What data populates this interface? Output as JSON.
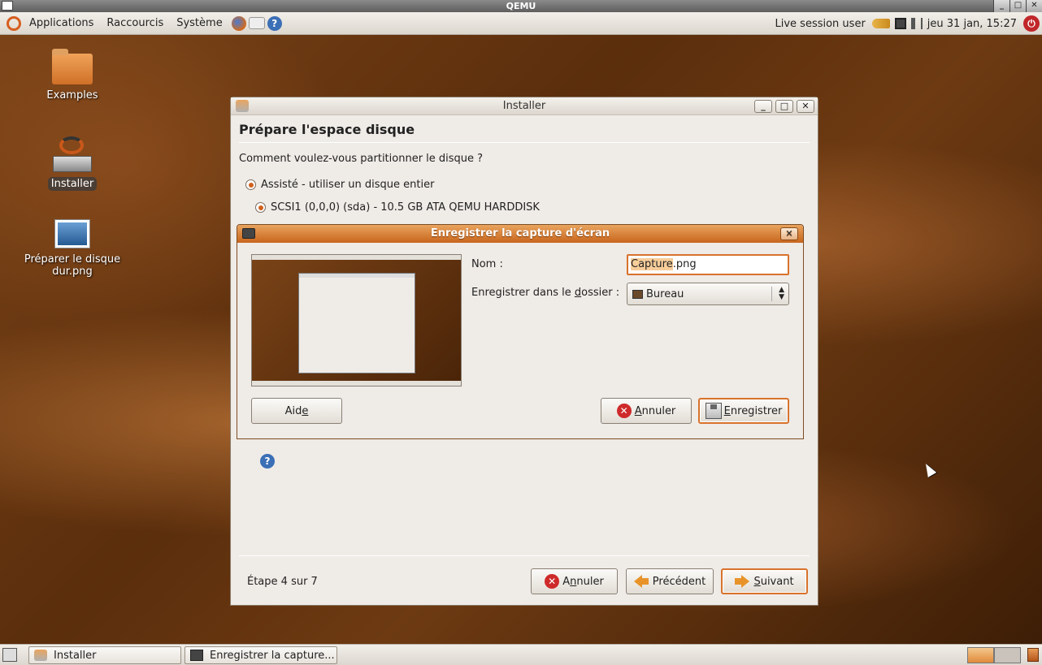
{
  "qemu": {
    "title": "QEMU"
  },
  "top_panel": {
    "menus": [
      "Applications",
      "Raccourcis",
      "Système"
    ],
    "launchers": [
      "firefox-icon",
      "mail-icon",
      "help-icon"
    ],
    "user": "Live session user",
    "clock": "jeu 31 jan, 15:27"
  },
  "desktop_icons": [
    {
      "label": "Examples",
      "icon": "folder-icon"
    },
    {
      "label": "Installer",
      "icon": "installer-icon"
    },
    {
      "label": "Préparer le disque dur.png",
      "icon": "image-file-icon"
    }
  ],
  "installer": {
    "title": "Installer",
    "heading": "Prépare l'espace disque",
    "question": "Comment voulez-vous partitionner le disque ?",
    "option_assisted": "Assisté - utiliser un disque entier",
    "option_disk": "SCSI1 (0,0,0) (sda) - 10.5 GB ATA QEMU HARDDISK",
    "step": "Étape 4 sur 7",
    "cancel_label_pre": "A",
    "cancel_label_u": "n",
    "cancel_label_post": "nuler",
    "previous_label": "Précédent",
    "next_label_u": "S",
    "next_label_post": "uivant"
  },
  "save_dialog": {
    "title": "Enregistrer la capture d'écran",
    "name_label": "Nom :",
    "name_value_selected": "Capture",
    "name_value_rest": ".png",
    "folder_label_pre": "Enregistrer dans le ",
    "folder_label_u": "d",
    "folder_label_post": "ossier :",
    "folder_value": "Bureau",
    "help_label_pre": "Aid",
    "help_label_u": "e",
    "cancel_label_u": "A",
    "cancel_label_post": "nnuler",
    "save_label_u": "E",
    "save_label_post": "nregistrer"
  },
  "taskbar": {
    "tasks": [
      "Installer",
      "Enregistrer la capture..."
    ]
  },
  "colors": {
    "accent": "#d8722c",
    "title_gradient_top": "#e9a45e",
    "title_gradient_bottom": "#c8651c"
  }
}
